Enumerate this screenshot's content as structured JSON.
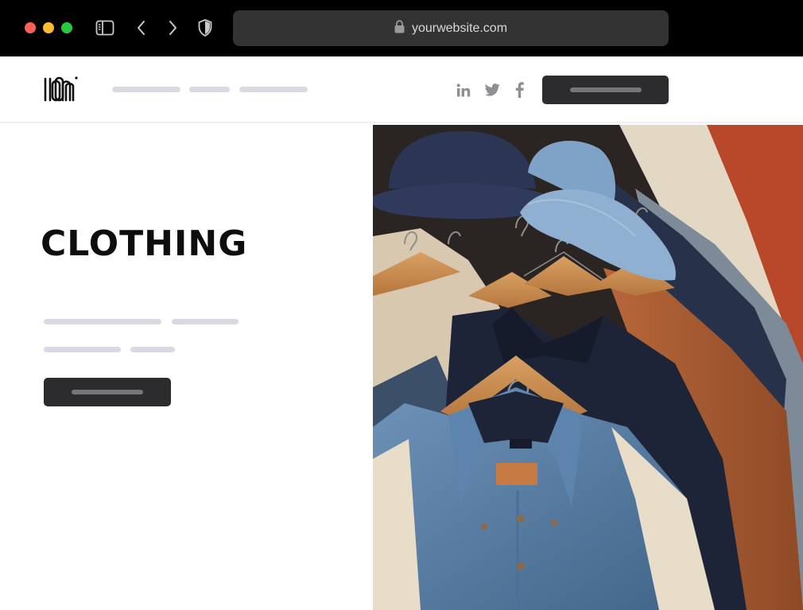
{
  "browser": {
    "url": "yourwebsite.com",
    "icons": {
      "sidebar": "sidebar-toggle-icon",
      "back": "chevron-left-icon",
      "forward": "chevron-right-icon",
      "privacy": "shield-icon",
      "lock": "lock-icon"
    }
  },
  "header": {
    "logo_alt": "logo",
    "social": [
      "linkedin-icon",
      "twitter-icon",
      "facebook-icon"
    ]
  },
  "hero": {
    "title": "CLOTHING",
    "image_alt": "Denim shirts and jackets on wooden hangers with hats"
  },
  "colors": {
    "chrome_bg": "#000000",
    "address_bg": "#333333",
    "button_bg": "#2c2c2e",
    "placeholder_line": "#d9d9e3",
    "title": "#0d0d0d"
  }
}
